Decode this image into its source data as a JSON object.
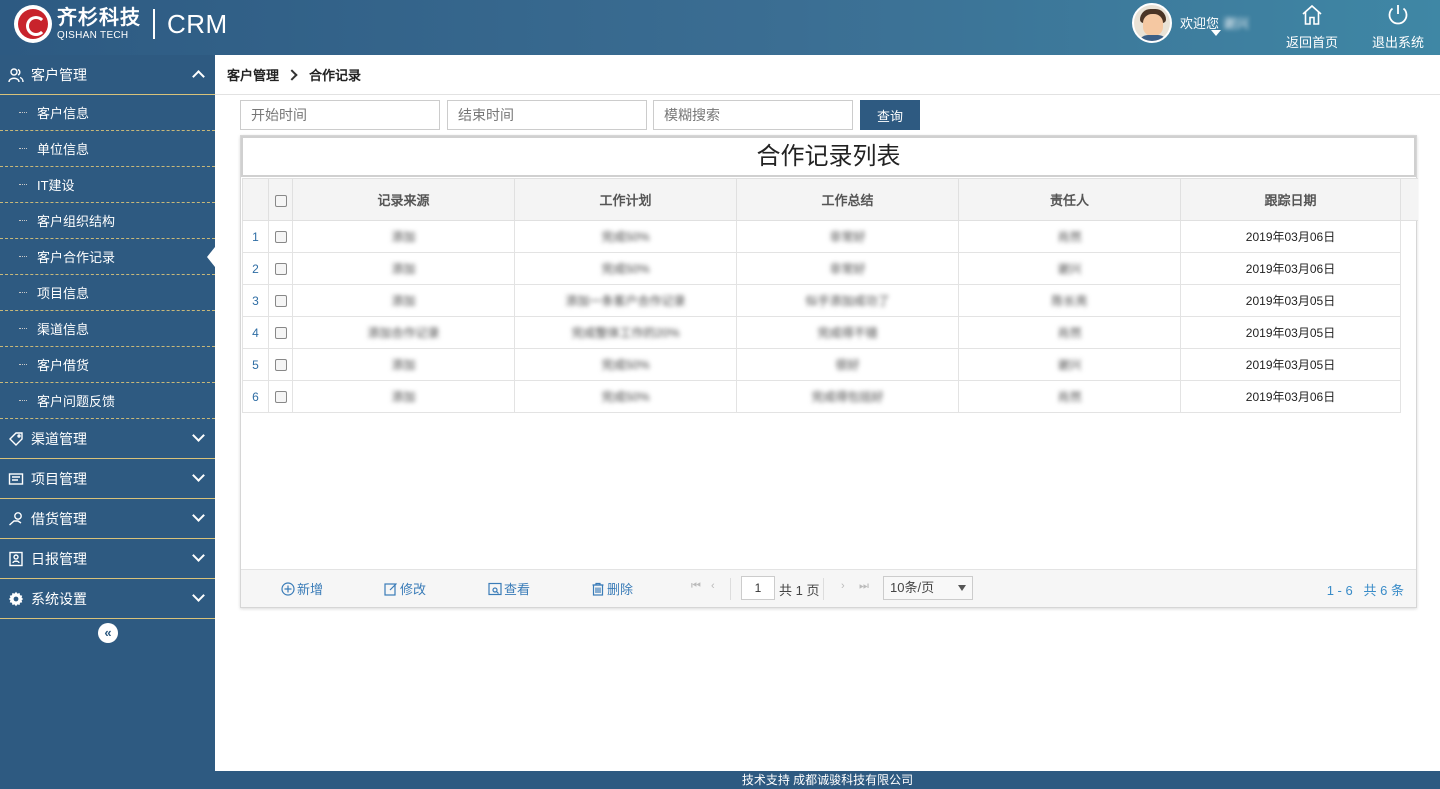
{
  "header": {
    "logo_cn": "齐杉科技",
    "logo_en": "QISHAN TECH",
    "app_name": "CRM",
    "welcome": "欢迎您",
    "username": "谢兴",
    "home_label": "返回首页",
    "logout_label": "退出系统"
  },
  "sidebar": {
    "groups": [
      {
        "label": "客户管理",
        "icon": "customer-icon",
        "expanded": true
      },
      {
        "label": "渠道管理",
        "icon": "tag-icon",
        "expanded": false
      },
      {
        "label": "项目管理",
        "icon": "folder-icon",
        "expanded": false
      },
      {
        "label": "借货管理",
        "icon": "handover-icon",
        "expanded": false
      },
      {
        "label": "日报管理",
        "icon": "report-icon",
        "expanded": false
      },
      {
        "label": "系统设置",
        "icon": "gear-icon",
        "expanded": false
      }
    ],
    "subitems": [
      "客户信息",
      "单位信息",
      "IT建设",
      "客户组织结构",
      "客户合作记录",
      "项目信息",
      "渠道信息",
      "客户借货",
      "客户问题反馈"
    ],
    "active_subitem": "客户合作记录",
    "collapse_symbol": "«"
  },
  "breadcrumb": {
    "parent": "客户管理",
    "current": "合作记录"
  },
  "search": {
    "start_placeholder": "开始时间",
    "end_placeholder": "结束时间",
    "keyword_placeholder": "模糊搜索",
    "button_label": "查询"
  },
  "table": {
    "title": "合作记录列表",
    "columns": [
      "记录来源",
      "工作计划",
      "工作总结",
      "责任人",
      "跟踪日期"
    ],
    "rows": [
      {
        "n": "1",
        "source": "添加",
        "plan": "完成50%",
        "summary": "非常好",
        "owner": "肖然",
        "date": "2019年03月06日"
      },
      {
        "n": "2",
        "source": "添加",
        "plan": "完成50%",
        "summary": "非常好",
        "owner": "谢兴",
        "date": "2019年03月06日"
      },
      {
        "n": "3",
        "source": "添加",
        "plan": "添加一条客户合作记录",
        "summary": "似乎添加成功了",
        "owner": "陈长亮",
        "date": "2019年03月05日"
      },
      {
        "n": "4",
        "source": "添加合作记录",
        "plan": "完成整体工作的20%",
        "summary": "完成得不错",
        "owner": "肖然",
        "date": "2019年03月05日"
      },
      {
        "n": "5",
        "source": "添加",
        "plan": "完成50%",
        "summary": "很好",
        "owner": "谢兴",
        "date": "2019年03月05日"
      },
      {
        "n": "6",
        "source": "添加",
        "plan": "完成50%",
        "summary": "完成得包括好",
        "owner": "肖然",
        "date": "2019年03月06日"
      }
    ]
  },
  "pager": {
    "add_label": "新增",
    "edit_label": "修改",
    "view_label": "查看",
    "delete_label": "删除",
    "page_value": "1",
    "total_pages": "共 1 页",
    "page_size": "10条/页",
    "info": "1 - 6   共 6 条"
  },
  "footer": {
    "text": "技术支持 成都诚骏科技有限公司"
  },
  "colors": {
    "primary": "#2e5a81",
    "accent_link": "#3a7cb8",
    "divider_gold": "#d8c27a"
  }
}
